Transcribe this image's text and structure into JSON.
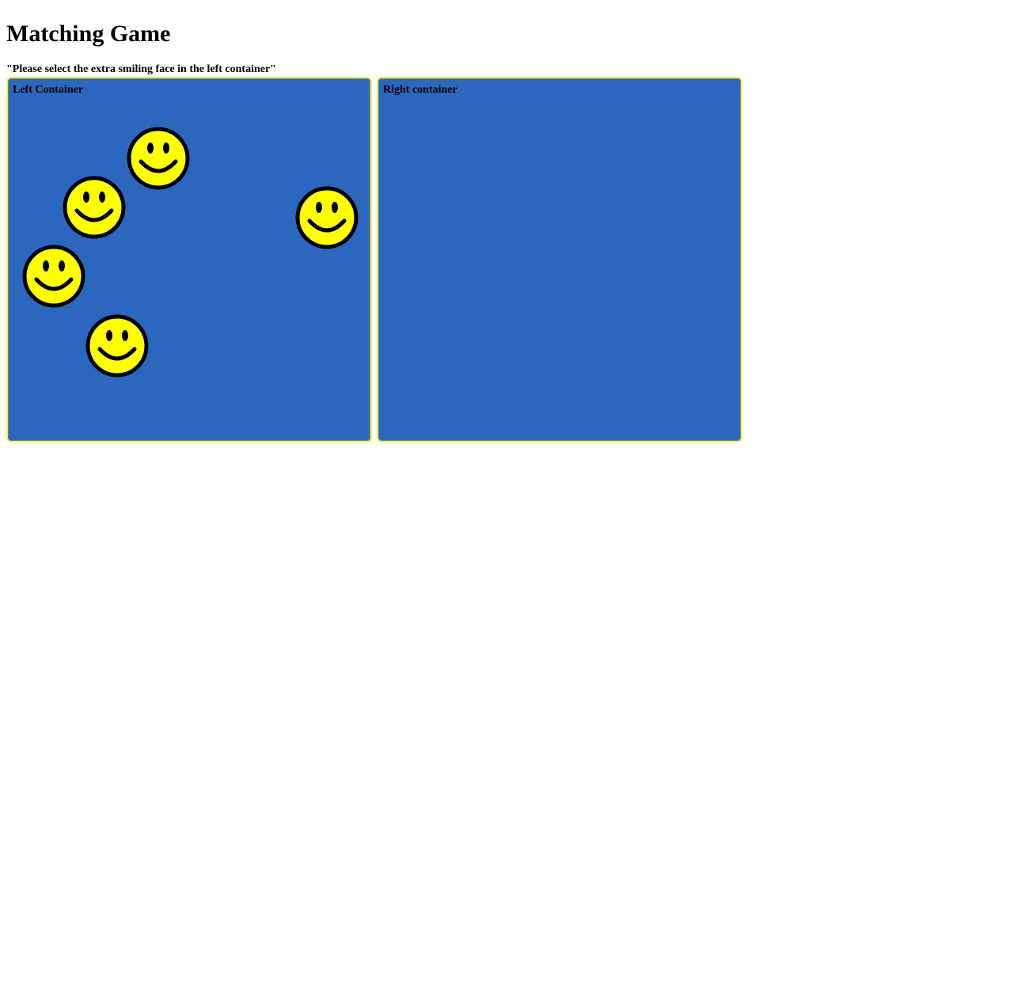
{
  "title": "Matching Game",
  "instruction": "\"Please select the extra smiling face in the left container\"",
  "left_container": {
    "label": "Left Container",
    "face_count": 5
  },
  "right_container": {
    "label": "Right container",
    "face_count": 0
  },
  "colors": {
    "container_bg": "#2c67be",
    "container_border": "#e8ef64",
    "face_fill": "#ffff00",
    "face_stroke": "#000000"
  },
  "icons": {
    "face": "smiley-face-icon"
  }
}
